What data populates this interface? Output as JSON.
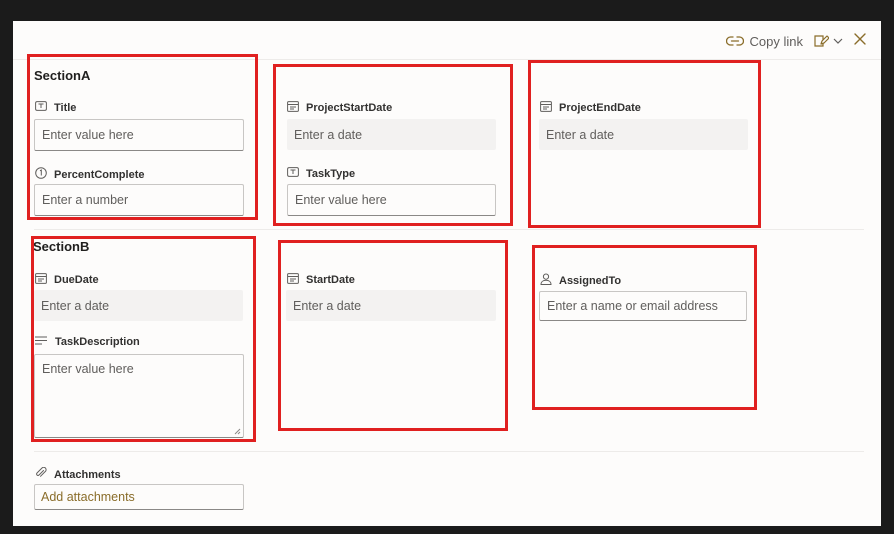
{
  "topbar": {
    "copy_link": "Copy link"
  },
  "sectionA": {
    "title": "SectionA",
    "fields": {
      "title": {
        "label": "Title",
        "placeholder": "Enter value here"
      },
      "percent_complete": {
        "label": "PercentComplete",
        "placeholder": "Enter a number"
      },
      "project_start_date": {
        "label": "ProjectStartDate",
        "placeholder": "Enter a date"
      },
      "task_type": {
        "label": "TaskType",
        "placeholder": "Enter value here"
      },
      "project_end_date": {
        "label": "ProjectEndDate",
        "placeholder": "Enter a date"
      }
    }
  },
  "sectionB": {
    "title": "SectionB",
    "fields": {
      "due_date": {
        "label": "DueDate",
        "placeholder": "Enter a date"
      },
      "task_description": {
        "label": "TaskDescription",
        "placeholder": "Enter value here"
      },
      "start_date": {
        "label": "StartDate",
        "placeholder": "Enter a date"
      },
      "assigned_to": {
        "label": "AssignedTo",
        "placeholder": "Enter a name or email address"
      }
    }
  },
  "attachments": {
    "label": "Attachments",
    "button": "Add attachments"
  },
  "colors": {
    "panel_bg": "#fdfcfb",
    "accent": "#8a6d2a",
    "highlight_box": "#e02020",
    "input_fill": "#f3f2f1"
  },
  "icons": {
    "text_field": "text-field-icon",
    "number": "number-icon",
    "date": "calendar-icon",
    "multiline": "multiline-text-icon",
    "person": "person-icon",
    "attachment": "paperclip-icon",
    "link": "link-icon",
    "edit": "edit-form-icon",
    "chevron": "chevron-down-icon",
    "close": "close-icon"
  }
}
